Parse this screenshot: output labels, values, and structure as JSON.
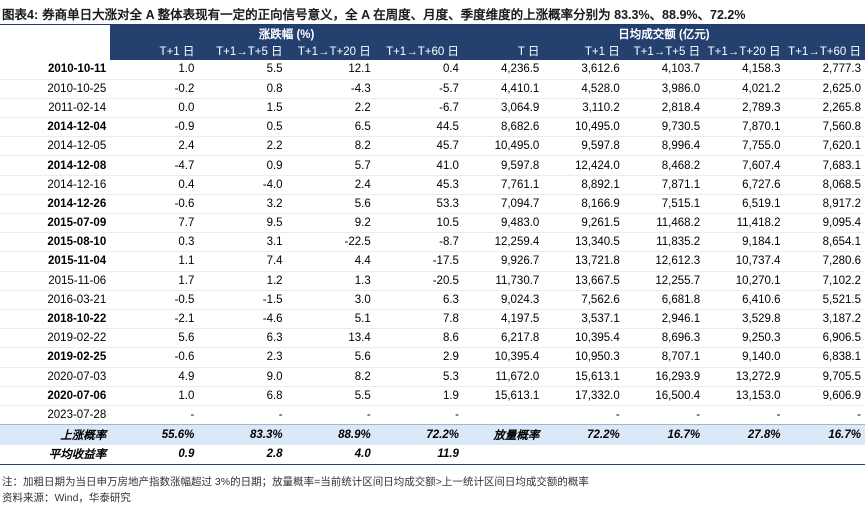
{
  "title": {
    "label": "图表4:",
    "text": "券商单日大涨对全 A 整体表现有一定的正向信号意义，全 A 在周度、月度、季度维度的上涨概率分别为 83.3%、88.9%、72.2%"
  },
  "table": {
    "groups": [
      "涨跌幅 (%)",
      "日均成交额 (亿元)"
    ],
    "columns": [
      "T+1 日",
      "T+1→T+5 日",
      "T+1→T+20 日",
      "T+1→T+60 日",
      "T 日",
      "T+1 日",
      "T+1→T+5 日",
      "T+1→T+20 日",
      "T+1→T+60 日"
    ],
    "rows": [
      {
        "date": "2010-10-11",
        "bold": true,
        "values": [
          "1.0",
          "5.5",
          "12.1",
          "0.4",
          "4,236.5",
          "3,612.6",
          "4,103.7",
          "4,158.3",
          "2,777.3"
        ]
      },
      {
        "date": "2010-10-25",
        "bold": false,
        "values": [
          "-0.2",
          "0.8",
          "-4.3",
          "-5.7",
          "4,410.1",
          "4,528.0",
          "3,986.0",
          "4,021.2",
          "2,625.0"
        ]
      },
      {
        "date": "2011-02-14",
        "bold": false,
        "values": [
          "0.0",
          "1.5",
          "2.2",
          "-6.7",
          "3,064.9",
          "3,110.2",
          "2,818.4",
          "2,789.3",
          "2,265.8"
        ]
      },
      {
        "date": "2014-12-04",
        "bold": true,
        "values": [
          "-0.9",
          "0.5",
          "6.5",
          "44.5",
          "8,682.6",
          "10,495.0",
          "9,730.5",
          "7,870.1",
          "7,560.8"
        ]
      },
      {
        "date": "2014-12-05",
        "bold": false,
        "values": [
          "2.4",
          "2.2",
          "8.2",
          "45.7",
          "10,495.0",
          "9,597.8",
          "8,996.4",
          "7,755.0",
          "7,620.1"
        ]
      },
      {
        "date": "2014-12-08",
        "bold": true,
        "values": [
          "-4.7",
          "0.9",
          "5.7",
          "41.0",
          "9,597.8",
          "12,424.0",
          "8,468.2",
          "7,607.4",
          "7,683.1"
        ]
      },
      {
        "date": "2014-12-16",
        "bold": false,
        "values": [
          "0.4",
          "-4.0",
          "2.4",
          "45.3",
          "7,761.1",
          "8,892.1",
          "7,871.1",
          "6,727.6",
          "8,068.5"
        ]
      },
      {
        "date": "2014-12-26",
        "bold": true,
        "values": [
          "-0.6",
          "3.2",
          "5.6",
          "53.3",
          "7,094.7",
          "8,166.9",
          "7,515.1",
          "6,519.1",
          "8,917.2"
        ]
      },
      {
        "date": "2015-07-09",
        "bold": true,
        "values": [
          "7.7",
          "9.5",
          "9.2",
          "10.5",
          "9,483.0",
          "9,261.5",
          "11,468.2",
          "11,418.2",
          "9,095.4"
        ]
      },
      {
        "date": "2015-08-10",
        "bold": true,
        "values": [
          "0.3",
          "3.1",
          "-22.5",
          "-8.7",
          "12,259.4",
          "13,340.5",
          "11,835.2",
          "9,184.1",
          "8,654.1"
        ]
      },
      {
        "date": "2015-11-04",
        "bold": true,
        "values": [
          "1.1",
          "7.4",
          "4.4",
          "-17.5",
          "9,926.7",
          "13,721.8",
          "12,612.3",
          "10,737.4",
          "7,280.6"
        ]
      },
      {
        "date": "2015-11-06",
        "bold": false,
        "values": [
          "1.7",
          "1.2",
          "1.3",
          "-20.5",
          "11,730.7",
          "13,667.5",
          "12,255.7",
          "10,270.1",
          "7,102.2"
        ]
      },
      {
        "date": "2016-03-21",
        "bold": false,
        "values": [
          "-0.5",
          "-1.5",
          "3.0",
          "6.3",
          "9,024.3",
          "7,562.6",
          "6,681.8",
          "6,410.6",
          "5,521.5"
        ]
      },
      {
        "date": "2018-10-22",
        "bold": true,
        "values": [
          "-2.1",
          "-4.6",
          "5.1",
          "7.8",
          "4,197.5",
          "3,537.1",
          "2,946.1",
          "3,529.8",
          "3,187.2"
        ]
      },
      {
        "date": "2019-02-22",
        "bold": false,
        "values": [
          "5.6",
          "6.3",
          "13.4",
          "8.6",
          "6,217.8",
          "10,395.4",
          "8,696.3",
          "9,250.3",
          "6,906.5"
        ]
      },
      {
        "date": "2019-02-25",
        "bold": true,
        "values": [
          "-0.6",
          "2.3",
          "5.6",
          "2.9",
          "10,395.4",
          "10,950.3",
          "8,707.1",
          "9,140.0",
          "6,838.1"
        ]
      },
      {
        "date": "2020-07-03",
        "bold": false,
        "values": [
          "4.9",
          "9.0",
          "8.2",
          "5.3",
          "11,672.0",
          "15,613.1",
          "16,293.9",
          "13,272.9",
          "9,705.5"
        ]
      },
      {
        "date": "2020-07-06",
        "bold": true,
        "values": [
          "1.0",
          "6.8",
          "5.5",
          "1.9",
          "15,613.1",
          "17,332.0",
          "16,500.4",
          "13,153.0",
          "9,606.9"
        ]
      },
      {
        "date": "2023-07-28",
        "bold": false,
        "values": [
          "-",
          "-",
          "-",
          "-",
          "",
          "-",
          "-",
          "-",
          "-"
        ]
      }
    ],
    "summary": {
      "label": "上涨概率",
      "values": [
        "55.6%",
        "83.3%",
        "88.9%",
        "72.2%"
      ],
      "label2": "放量概率",
      "values2": [
        "72.2%",
        "16.7%",
        "27.8%",
        "16.7%"
      ]
    },
    "average": {
      "label": "平均收益率",
      "values": [
        "0.9",
        "2.8",
        "4.0",
        "11.9"
      ]
    }
  },
  "notes": {
    "note": "注：加粗日期为当日申万房地产指数涨幅超过 3%的日期；放量概率=当前统计区间日均成交额>上一统计区间日均成交额的概率",
    "source": "资料来源：Wind，华泰研究"
  },
  "colors": {
    "header_bg": "#24406e",
    "summary_bg": "#dbe8f8"
  }
}
